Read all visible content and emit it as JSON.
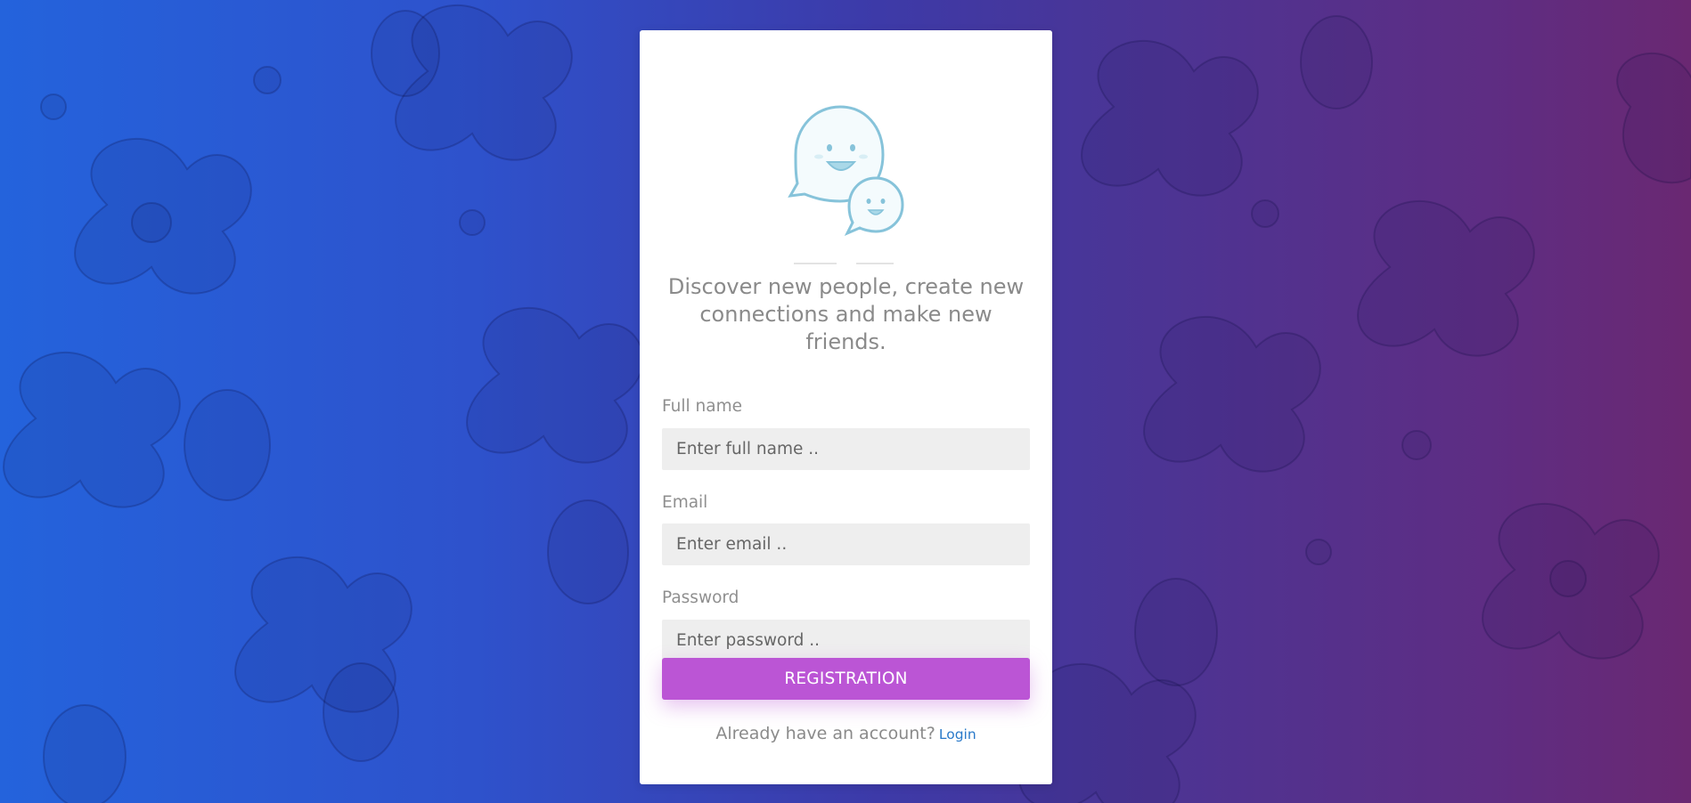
{
  "theme": {
    "accent": "#bb55d5",
    "link": "#2979c9",
    "gradient_start": "#2463dc",
    "gradient_end": "#6a2872"
  },
  "logo": {
    "icon": "chat-bubbles-smiling-icon"
  },
  "tagline": "Discover new people, create new connections and make new friends.",
  "form": {
    "full_name": {
      "label": "Full name",
      "placeholder": "Enter full name .."
    },
    "email": {
      "label": "Email",
      "placeholder": "Enter email .."
    },
    "password": {
      "label": "Password",
      "placeholder": "Enter password .."
    },
    "submit_label": "REGISTRATION"
  },
  "footer": {
    "prompt": "Already have an account?",
    "login_link": "Login"
  }
}
